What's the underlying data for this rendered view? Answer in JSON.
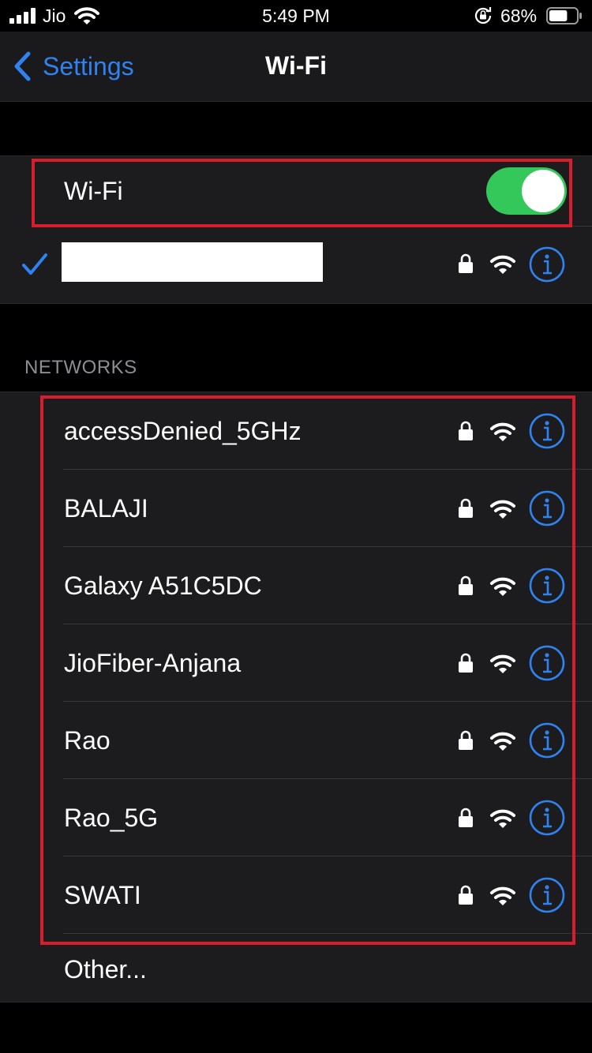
{
  "status_bar": {
    "carrier": "Jio",
    "time": "5:49 PM",
    "battery_percent": "68%",
    "battery_level": 0.68,
    "icons": [
      "signal-bars-icon",
      "wifi-icon",
      "orientation-lock-icon",
      "battery-icon"
    ]
  },
  "nav": {
    "back_label": "Settings",
    "title": "Wi-Fi"
  },
  "wifi_toggle": {
    "label": "Wi-Fi",
    "on": true
  },
  "connected_network": {
    "name": "",
    "secured": true
  },
  "networks_header": "NETWORKS",
  "networks": [
    {
      "name": "accessDenied_5GHz",
      "secured": true
    },
    {
      "name": "BALAJI",
      "secured": true
    },
    {
      "name": "Galaxy A51C5DC",
      "secured": true
    },
    {
      "name": "JioFiber-Anjana",
      "secured": true
    },
    {
      "name": "Rao",
      "secured": true
    },
    {
      "name": "Rao_5G",
      "secured": true
    },
    {
      "name": "SWATI",
      "secured": true
    }
  ],
  "other_label": "Other...",
  "colors": {
    "accent": "#2f82ef",
    "toggle_on": "#34c759",
    "highlight": "#d81e2c"
  }
}
